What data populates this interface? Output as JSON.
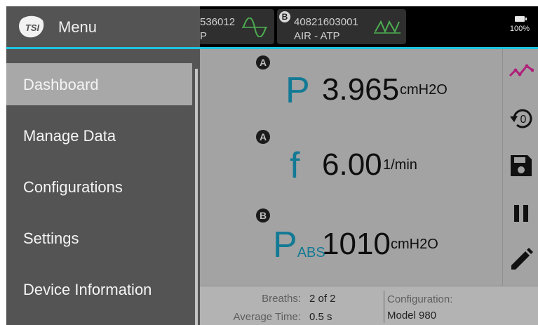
{
  "menu": {
    "title": "Menu",
    "logo_text": "TSI",
    "items": [
      {
        "label": "Dashboard",
        "active": true
      },
      {
        "label": "Manage Data"
      },
      {
        "label": "Configurations"
      },
      {
        "label": "Settings"
      },
      {
        "label": "Device Information"
      }
    ]
  },
  "topbar": {
    "sensor1": {
      "id": "536012",
      "unit": "P"
    },
    "sensor2": {
      "badge": "B",
      "id": "40821603001",
      "unit": "AIR - ATP"
    },
    "battery": "100%"
  },
  "readings": [
    {
      "badge": "A",
      "symbol": "P",
      "subscript": "",
      "value": "3.965",
      "unit": "cmH2O"
    },
    {
      "badge": "A",
      "symbol": "f",
      "subscript": "",
      "value": "6.00",
      "unit": "1/min"
    },
    {
      "badge": "B",
      "symbol": "P",
      "subscript": "ABS",
      "value": "1010",
      "unit": "cmH2O"
    }
  ],
  "footer": {
    "breaths_label": "Breaths:",
    "breaths_value": "2 of 2",
    "avg_time_label": "Average Time:",
    "avg_time_value": "0.5 s",
    "config_label": "Configuration:",
    "config_value": "Model 980"
  },
  "tools": [
    "chart-icon",
    "reset-zero-icon",
    "save-icon",
    "pause-icon",
    "edit-icon"
  ],
  "colors": {
    "accent": "#1ec3e0",
    "symbol": "#137a95",
    "chart_icon": "#b0217a",
    "wave": "#4caf50"
  }
}
